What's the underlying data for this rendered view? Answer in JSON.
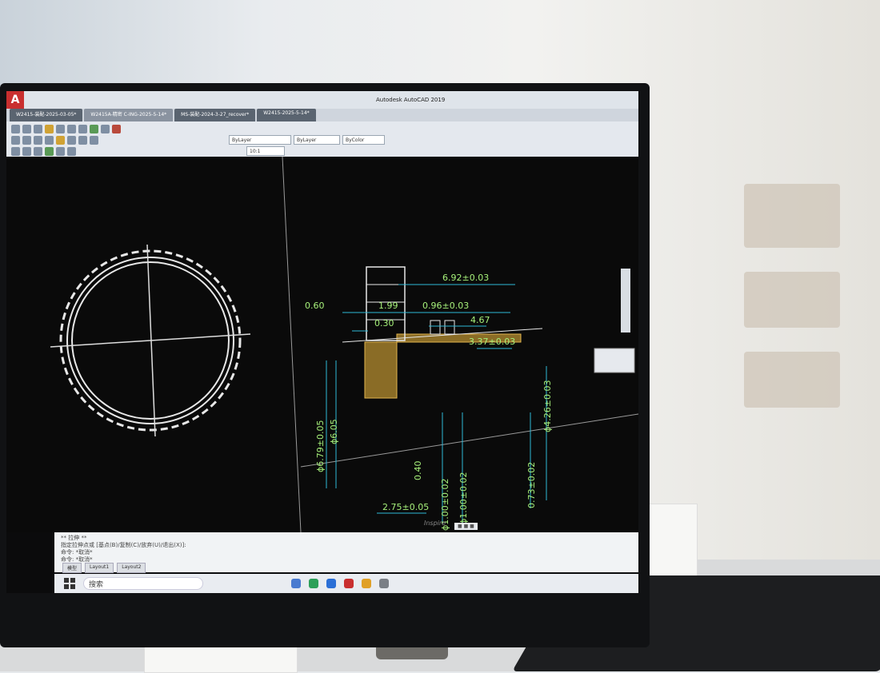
{
  "app": {
    "logo_letter": "A",
    "window_title": "Autodesk AutoCAD 2019"
  },
  "tabs": [
    {
      "label": "W2415-装配-2025-03-05*"
    },
    {
      "label": "W2415A-精密 C-ING-2025-5-14*"
    },
    {
      "label": "MS-装配-2024-3-27_recover*"
    },
    {
      "label": "W2415-2025-5-14*"
    }
  ],
  "ribbon": {
    "layer_combo": "ByLayer",
    "linetype_combo": "ByLayer",
    "color_combo": "ByColor",
    "scale_combo": "10:1"
  },
  "dimensions": {
    "d1": "6.92±0.03",
    "d2": "0.60",
    "d3": "1.99",
    "d4": "0.96±0.03",
    "d5": "0.30",
    "d6": "4.67",
    "d7": "3.37±0.03",
    "d8": "ϕ6.79±0.05",
    "d9": "ϕ6.05",
    "d10": "ϕ4.26±0.03",
    "d11": "0.40",
    "d12": "2.75±0.05",
    "d13": "ϕ1.00±0.02",
    "d14": "ϕ1.00±0.02",
    "d15": "0.73±0.02"
  },
  "command": {
    "line1": "** 拉伸 **",
    "line2": "指定拉伸点或 [基点(B)/复制(C)/放弃(U)/退出(X)]:",
    "line3": "命令: *取消*",
    "line4": "命令: *取消*"
  },
  "layouts": [
    {
      "label": "模型"
    },
    {
      "label": "Layout1"
    },
    {
      "label": "Layout2"
    }
  ],
  "taskbar": {
    "search_label": "搜索"
  },
  "monitor_brand": "Inspire"
}
